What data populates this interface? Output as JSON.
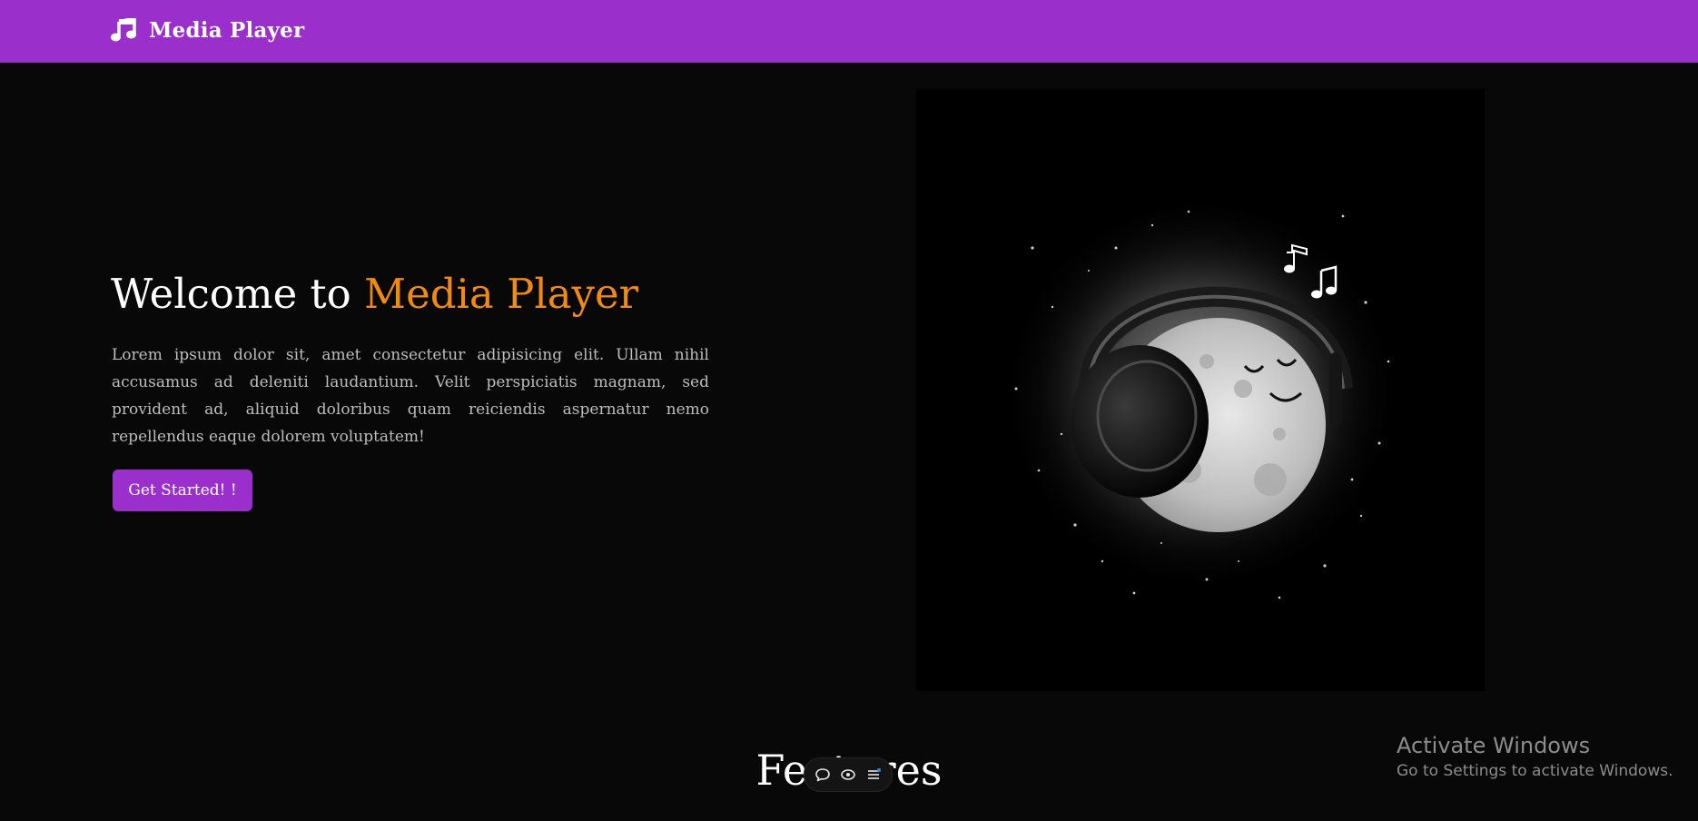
{
  "navbar": {
    "brand": "Media Player",
    "brand_icon": "music-note-icon",
    "background": "#9a2fcb"
  },
  "hero": {
    "title_prefix": "Welcome to ",
    "title_accent": "Media Player",
    "accent_color": "#f08a12",
    "description": "Lorem ipsum dolor sit, amet consectetur adipisicing elit. Ullam nihil accusamus ad deleniti laudantium. Velit perspiciatis magnam, sed provident ad, aliquid doloribus quam reiciendis aspernatur nemo repellendus eaque dolorem voluptatem!",
    "cta_label": "Get Started! !",
    "image": "moon-with-headphones-illustration"
  },
  "features": {
    "title": "Features"
  },
  "floating_toolbar": {
    "icons": [
      "chat-bubble-icon",
      "eye-icon",
      "list-icon"
    ]
  },
  "watermark": {
    "title": "Activate Windows",
    "subtitle": "Go to Settings to activate Windows."
  }
}
